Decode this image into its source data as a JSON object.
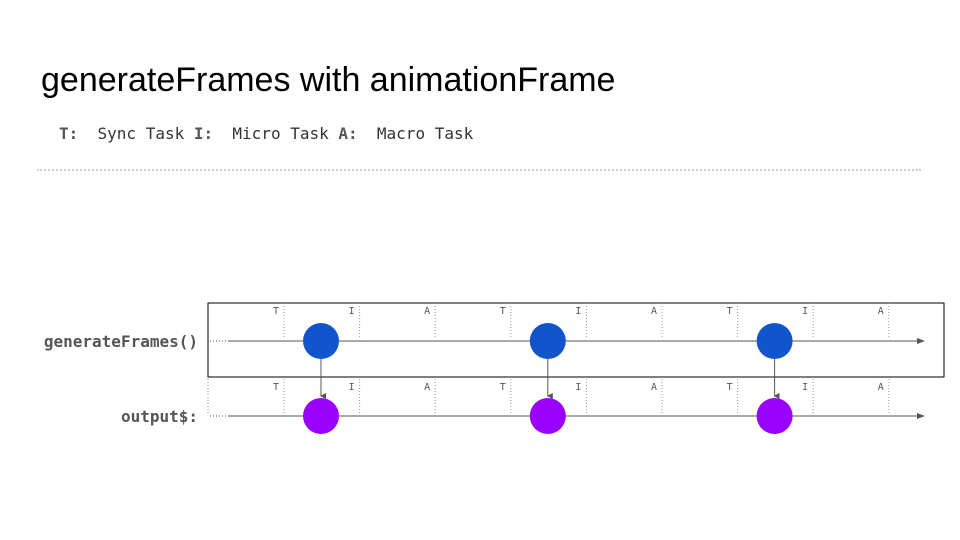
{
  "title": "generateFrames with animationFrame",
  "legend": [
    {
      "key": "T:",
      "label": "Sync Task"
    },
    {
      "key": "I:",
      "label": "Micro Task"
    },
    {
      "key": "A:",
      "label": "Macro Task"
    }
  ],
  "rows": [
    {
      "label": "generateFrames()",
      "color": "#1155cc",
      "framed": true
    },
    {
      "label": "output$:",
      "color": "#9900ff",
      "framed": false
    }
  ],
  "task_markers": [
    "T",
    "I",
    "A",
    "T",
    "I",
    "A",
    "T",
    "I",
    "A"
  ],
  "emissions": 3
}
